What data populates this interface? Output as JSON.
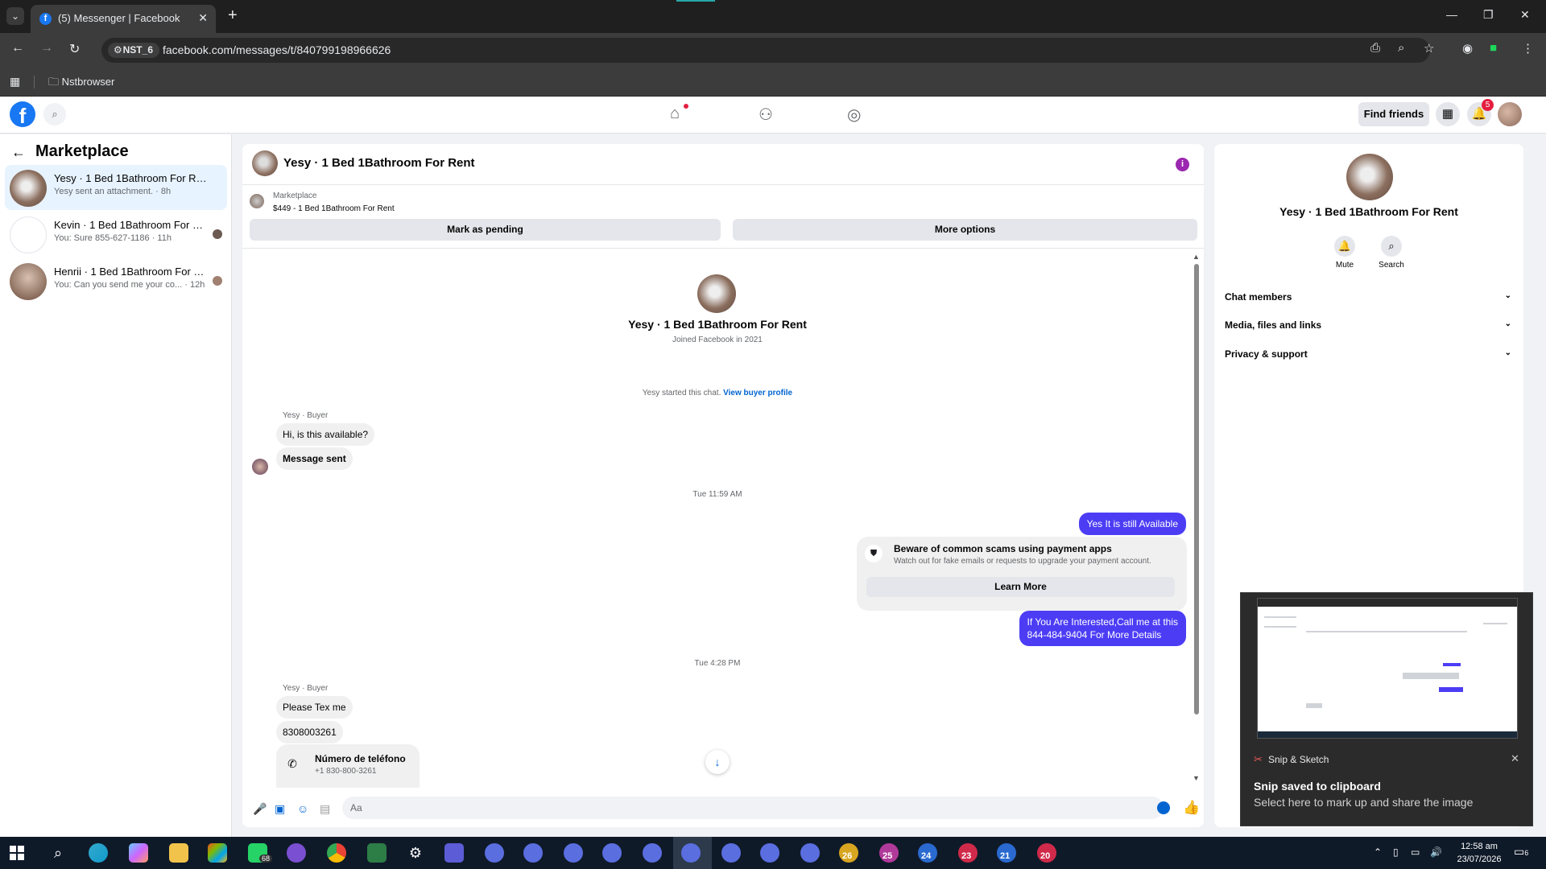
{
  "browser": {
    "tab_title": "(5) Messenger | Facebook",
    "url": "facebook.com/messages/t/840799198966626",
    "profile_chip": "NST_6",
    "bookmark_folder": "Nstbrowser"
  },
  "header": {
    "find_friends": "Find friends",
    "notification_count": "5"
  },
  "chat_list": {
    "title": "Marketplace",
    "items": [
      {
        "name": "Yesy · 1 Bed 1Bathroom For Rent",
        "preview": "Yesy sent an attachment. · 8h"
      },
      {
        "name": "Kevin · 1 Bed 1Bathroom For Rent",
        "preview": "You: Sure 855-627-1186 · 11h"
      },
      {
        "name": "Henrii · 1 Bed 1Bathroom For Rent",
        "preview": "You: Can you send me your co... · 12h"
      }
    ]
  },
  "conversation": {
    "title": "Yesy · 1 Bed 1Bathroom For Rent",
    "marketplace_label": "Marketplace",
    "listing": "$449 - 1 Bed 1Bathroom For Rent",
    "mark_pending": "Mark as pending",
    "more_options": "More options",
    "intro_name": "Yesy · 1 Bed 1Bathroom For Rent",
    "intro_joined": "Joined Facebook in 2021",
    "started_text": "Yesy started this chat.",
    "view_profile": "View buyer profile",
    "sender_label": "Yesy · Buyer",
    "msg1": "Hi, is this available?",
    "msg2": "Message sent",
    "time1": "Tue 11:59 AM",
    "out1": "Yes It is still Available",
    "scam_title": "Beware of common scams using payment apps",
    "scam_sub": "Watch out for fake emails or requests to upgrade your payment account.",
    "learn_more": "Learn More",
    "out2_line1": "If You Are Interested,Call me at this",
    "out2_line2": "844-484-9404 For More Details",
    "time2": "Tue 4:28 PM",
    "sender_label2": "Yesy · Buyer",
    "msg3": "Please Tex me",
    "msg4": "8308003261",
    "phone_title": "Número de teléfono",
    "phone_number": "+1 830-800-3261",
    "composer_placeholder": "Aa"
  },
  "right_panel": {
    "name": "Yesy · 1 Bed 1Bathroom For Rent",
    "mute": "Mute",
    "search": "Search",
    "sections": [
      "Chat members",
      "Media, files and links",
      "Privacy & support"
    ]
  },
  "toast": {
    "app": "Snip & Sketch",
    "title": "Snip saved to clipboard",
    "subtitle": "Select here to mark up and share the image"
  },
  "taskbar": {
    "whatsapp_badge": "68",
    "numbered_apps": [
      "26",
      "25",
      "24",
      "23",
      "21",
      "20"
    ],
    "time": "12:58 am",
    "date": "23/07/2026",
    "notif_count": "6"
  },
  "colors": {
    "brand": "#1877f2",
    "outgoing_bubble": "#4c3df5",
    "active_item": "#e7f3ff",
    "taskbar": "#0f1a29"
  }
}
